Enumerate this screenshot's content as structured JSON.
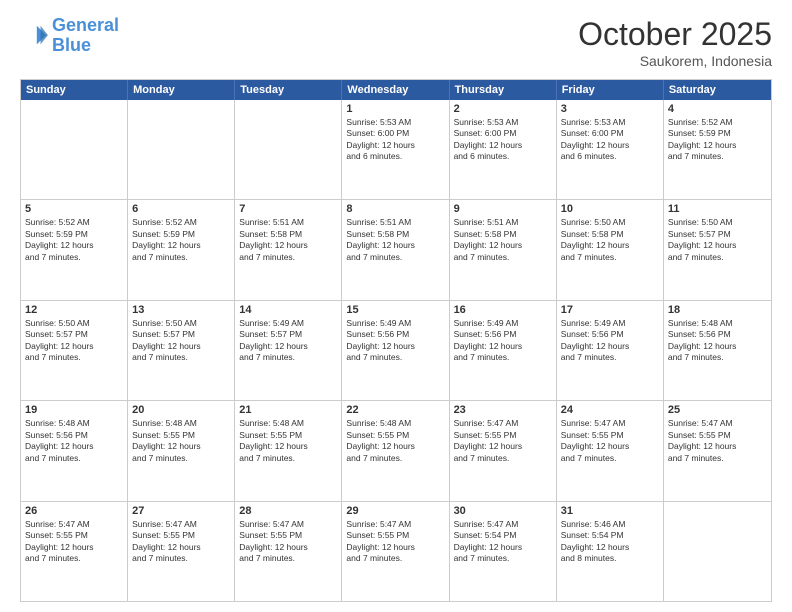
{
  "logo": {
    "line1": "General",
    "line2": "Blue"
  },
  "title": "October 2025",
  "location": "Saukorem, Indonesia",
  "weekdays": [
    "Sunday",
    "Monday",
    "Tuesday",
    "Wednesday",
    "Thursday",
    "Friday",
    "Saturday"
  ],
  "rows": [
    [
      {
        "day": "",
        "lines": []
      },
      {
        "day": "",
        "lines": []
      },
      {
        "day": "",
        "lines": []
      },
      {
        "day": "1",
        "lines": [
          "Sunrise: 5:53 AM",
          "Sunset: 6:00 PM",
          "Daylight: 12 hours",
          "and 6 minutes."
        ]
      },
      {
        "day": "2",
        "lines": [
          "Sunrise: 5:53 AM",
          "Sunset: 6:00 PM",
          "Daylight: 12 hours",
          "and 6 minutes."
        ]
      },
      {
        "day": "3",
        "lines": [
          "Sunrise: 5:53 AM",
          "Sunset: 6:00 PM",
          "Daylight: 12 hours",
          "and 6 minutes."
        ]
      },
      {
        "day": "4",
        "lines": [
          "Sunrise: 5:52 AM",
          "Sunset: 5:59 PM",
          "Daylight: 12 hours",
          "and 7 minutes."
        ]
      }
    ],
    [
      {
        "day": "5",
        "lines": [
          "Sunrise: 5:52 AM",
          "Sunset: 5:59 PM",
          "Daylight: 12 hours",
          "and 7 minutes."
        ]
      },
      {
        "day": "6",
        "lines": [
          "Sunrise: 5:52 AM",
          "Sunset: 5:59 PM",
          "Daylight: 12 hours",
          "and 7 minutes."
        ]
      },
      {
        "day": "7",
        "lines": [
          "Sunrise: 5:51 AM",
          "Sunset: 5:58 PM",
          "Daylight: 12 hours",
          "and 7 minutes."
        ]
      },
      {
        "day": "8",
        "lines": [
          "Sunrise: 5:51 AM",
          "Sunset: 5:58 PM",
          "Daylight: 12 hours",
          "and 7 minutes."
        ]
      },
      {
        "day": "9",
        "lines": [
          "Sunrise: 5:51 AM",
          "Sunset: 5:58 PM",
          "Daylight: 12 hours",
          "and 7 minutes."
        ]
      },
      {
        "day": "10",
        "lines": [
          "Sunrise: 5:50 AM",
          "Sunset: 5:58 PM",
          "Daylight: 12 hours",
          "and 7 minutes."
        ]
      },
      {
        "day": "11",
        "lines": [
          "Sunrise: 5:50 AM",
          "Sunset: 5:57 PM",
          "Daylight: 12 hours",
          "and 7 minutes."
        ]
      }
    ],
    [
      {
        "day": "12",
        "lines": [
          "Sunrise: 5:50 AM",
          "Sunset: 5:57 PM",
          "Daylight: 12 hours",
          "and 7 minutes."
        ]
      },
      {
        "day": "13",
        "lines": [
          "Sunrise: 5:50 AM",
          "Sunset: 5:57 PM",
          "Daylight: 12 hours",
          "and 7 minutes."
        ]
      },
      {
        "day": "14",
        "lines": [
          "Sunrise: 5:49 AM",
          "Sunset: 5:57 PM",
          "Daylight: 12 hours",
          "and 7 minutes."
        ]
      },
      {
        "day": "15",
        "lines": [
          "Sunrise: 5:49 AM",
          "Sunset: 5:56 PM",
          "Daylight: 12 hours",
          "and 7 minutes."
        ]
      },
      {
        "day": "16",
        "lines": [
          "Sunrise: 5:49 AM",
          "Sunset: 5:56 PM",
          "Daylight: 12 hours",
          "and 7 minutes."
        ]
      },
      {
        "day": "17",
        "lines": [
          "Sunrise: 5:49 AM",
          "Sunset: 5:56 PM",
          "Daylight: 12 hours",
          "and 7 minutes."
        ]
      },
      {
        "day": "18",
        "lines": [
          "Sunrise: 5:48 AM",
          "Sunset: 5:56 PM",
          "Daylight: 12 hours",
          "and 7 minutes."
        ]
      }
    ],
    [
      {
        "day": "19",
        "lines": [
          "Sunrise: 5:48 AM",
          "Sunset: 5:56 PM",
          "Daylight: 12 hours",
          "and 7 minutes."
        ]
      },
      {
        "day": "20",
        "lines": [
          "Sunrise: 5:48 AM",
          "Sunset: 5:55 PM",
          "Daylight: 12 hours",
          "and 7 minutes."
        ]
      },
      {
        "day": "21",
        "lines": [
          "Sunrise: 5:48 AM",
          "Sunset: 5:55 PM",
          "Daylight: 12 hours",
          "and 7 minutes."
        ]
      },
      {
        "day": "22",
        "lines": [
          "Sunrise: 5:48 AM",
          "Sunset: 5:55 PM",
          "Daylight: 12 hours",
          "and 7 minutes."
        ]
      },
      {
        "day": "23",
        "lines": [
          "Sunrise: 5:47 AM",
          "Sunset: 5:55 PM",
          "Daylight: 12 hours",
          "and 7 minutes."
        ]
      },
      {
        "day": "24",
        "lines": [
          "Sunrise: 5:47 AM",
          "Sunset: 5:55 PM",
          "Daylight: 12 hours",
          "and 7 minutes."
        ]
      },
      {
        "day": "25",
        "lines": [
          "Sunrise: 5:47 AM",
          "Sunset: 5:55 PM",
          "Daylight: 12 hours",
          "and 7 minutes."
        ]
      }
    ],
    [
      {
        "day": "26",
        "lines": [
          "Sunrise: 5:47 AM",
          "Sunset: 5:55 PM",
          "Daylight: 12 hours",
          "and 7 minutes."
        ]
      },
      {
        "day": "27",
        "lines": [
          "Sunrise: 5:47 AM",
          "Sunset: 5:55 PM",
          "Daylight: 12 hours",
          "and 7 minutes."
        ]
      },
      {
        "day": "28",
        "lines": [
          "Sunrise: 5:47 AM",
          "Sunset: 5:55 PM",
          "Daylight: 12 hours",
          "and 7 minutes."
        ]
      },
      {
        "day": "29",
        "lines": [
          "Sunrise: 5:47 AM",
          "Sunset: 5:55 PM",
          "Daylight: 12 hours",
          "and 7 minutes."
        ]
      },
      {
        "day": "30",
        "lines": [
          "Sunrise: 5:47 AM",
          "Sunset: 5:54 PM",
          "Daylight: 12 hours",
          "and 7 minutes."
        ]
      },
      {
        "day": "31",
        "lines": [
          "Sunrise: 5:46 AM",
          "Sunset: 5:54 PM",
          "Daylight: 12 hours",
          "and 8 minutes."
        ]
      },
      {
        "day": "",
        "lines": []
      }
    ]
  ]
}
